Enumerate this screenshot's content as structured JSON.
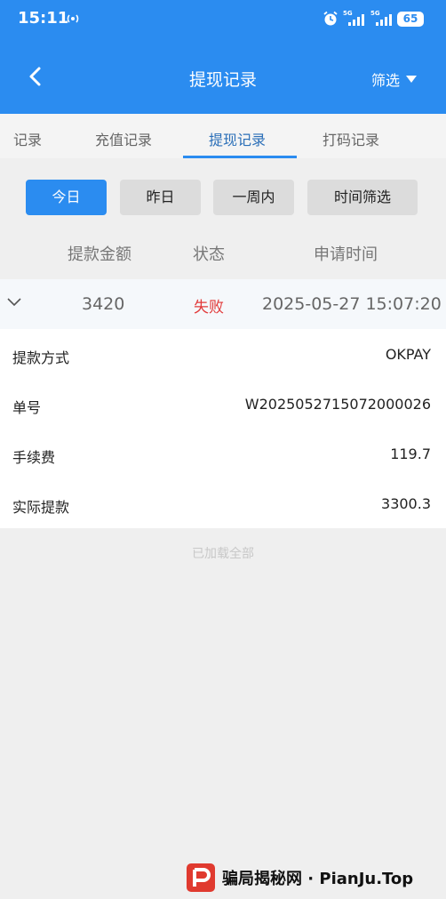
{
  "status_bar": {
    "time": "15:11",
    "network_1": "5G",
    "network_2": "5G",
    "battery": "65"
  },
  "header": {
    "title": "提现记录",
    "filter_label": "筛选"
  },
  "tabs": [
    {
      "label": "记录"
    },
    {
      "label": "充值记录"
    },
    {
      "label": "提现记录",
      "active": true
    },
    {
      "label": "打码记录"
    }
  ],
  "date_filters": [
    {
      "label": "今日",
      "active": true
    },
    {
      "label": "昨日"
    },
    {
      "label": "一周内"
    },
    {
      "label": "时间筛选"
    }
  ],
  "columns": [
    "提款金额",
    "状态",
    "申请时间"
  ],
  "record": {
    "amount": "3420",
    "status": "失败",
    "time": "2025-05-27 15:07:20",
    "details": [
      {
        "label": "提款方式",
        "value": "OKPAY"
      },
      {
        "label": "单号",
        "value": "W2025052715072000026"
      },
      {
        "label": "手续费",
        "value": "119.7"
      },
      {
        "label": "实际提款",
        "value": "3300.3"
      }
    ]
  },
  "footer_text": "已加载全部",
  "watermark": {
    "text": "骗局揭秘网 · PianJu.Top"
  },
  "colors": {
    "primary": "#2b8cf0",
    "status_fail": "#e23a3a",
    "watermark_logo": "#e03a2f"
  }
}
